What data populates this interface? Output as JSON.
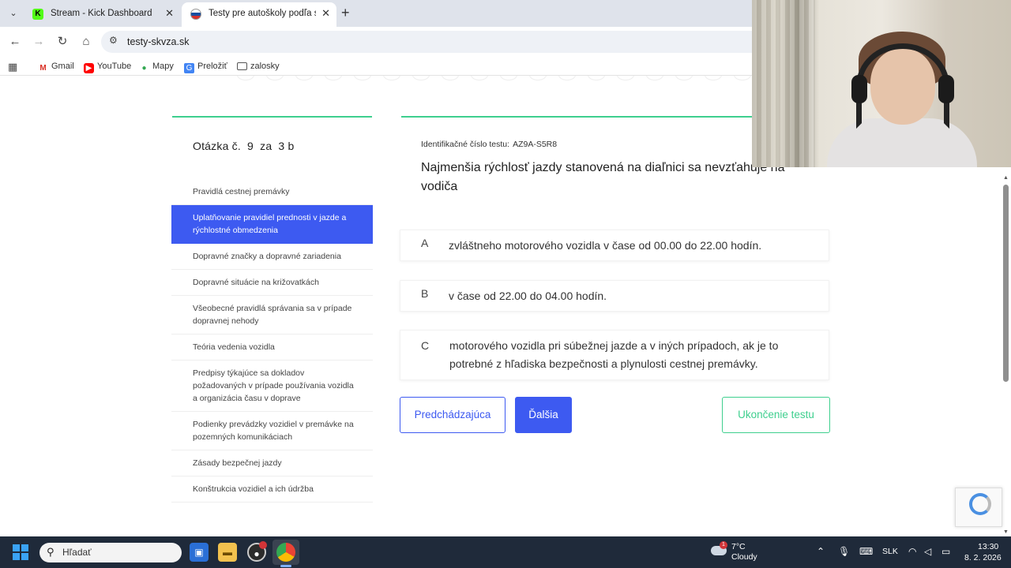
{
  "browser": {
    "tabs": [
      {
        "title": "Stream - Kick Dashboard",
        "favicon": "kick-icon"
      },
      {
        "title": "Testy pre autoškoly podľa skupín",
        "favicon": "slovakia-flag-icon"
      }
    ],
    "url": "testy-skvza.sk",
    "bookmarks": [
      {
        "label": "Gmail",
        "icon": "gmail-icon"
      },
      {
        "label": "YouTube",
        "icon": "youtube-icon"
      },
      {
        "label": "Mapy",
        "icon": "maps-icon"
      },
      {
        "label": "Preložiť",
        "icon": "translate-icon"
      },
      {
        "label": "zalosky",
        "icon": "folder-icon"
      }
    ]
  },
  "sidebar": {
    "question_label": "Otázka č.",
    "question_number": "9",
    "points_label": "za",
    "points_value": "3 b",
    "categories": [
      {
        "label": "Pravidlá cestnej premávky",
        "active": false
      },
      {
        "label": "Uplatňovanie pravidiel prednosti v jazde a rýchlostné obmedzenia",
        "active": true
      },
      {
        "label": "Dopravné značky a dopravné zariadenia",
        "active": false
      },
      {
        "label": "Dopravné situácie na križovatkách",
        "active": false
      },
      {
        "label": "Všeobecné pravidlá správania sa v prípade dopravnej nehody",
        "active": false
      },
      {
        "label": "Teória vedenia vozidla",
        "active": false
      },
      {
        "label": "Predpisy týkajúce sa dokladov požadovaných v prípade používania vozidla a organizácia času v doprave",
        "active": false
      },
      {
        "label": "Podienky prevádzky vozidiel v premávke na pozemných komunikáciach",
        "active": false
      },
      {
        "label": "Zásady bezpečnej jazdy",
        "active": false
      },
      {
        "label": "Konštrukcia vozidiel a ich údržba",
        "active": false
      }
    ]
  },
  "question": {
    "id_label": "Identifikačné číslo testu:",
    "id_value": "AZ9A-S5R8",
    "text": "Najmenšia rýchlosť jazdy stanovená na diaľnici sa nevzťahuje na vodiča",
    "answers": [
      {
        "letter": "A",
        "text": "zvláštneho motorového vozidla v čase od 00.00 do 22.00 hodín."
      },
      {
        "letter": "B",
        "text": "v čase od 22.00 do 04.00 hodín."
      },
      {
        "letter": "C",
        "text": "motorového vozidla pri súbežnej jazde a v iných prípadoch, ak je to potrebné z hľadiska bezpečnosti a plynulosti cestnej premávky."
      }
    ]
  },
  "buttons": {
    "prev": "Predchádzajúca",
    "next": "Ďalšia",
    "end": "Ukončenie testu"
  },
  "taskbar": {
    "search_placeholder": "Hľadať",
    "weather_temp": "7°C",
    "weather_desc": "Cloudy",
    "weather_badge": "1",
    "language": "SLK",
    "time": "13:30",
    "date": "8. 2. 2026"
  },
  "colors": {
    "accent_blue": "#3d5af1",
    "accent_green": "#3ecf8e"
  }
}
